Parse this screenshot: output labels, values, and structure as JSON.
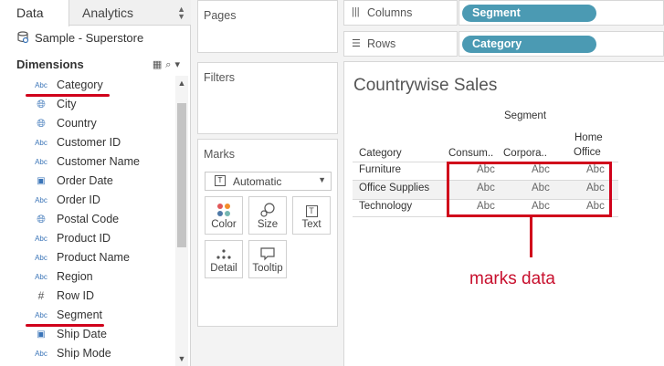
{
  "left_pane": {
    "tabs": [
      {
        "label": "Data"
      },
      {
        "label": "Analytics"
      }
    ],
    "datasource": "Sample - Superstore",
    "dimensions_title": "Dimensions",
    "fields": [
      {
        "type": "Abc",
        "label": "Category"
      },
      {
        "type": "globe",
        "label": "City"
      },
      {
        "type": "globe",
        "label": "Country"
      },
      {
        "type": "Abc",
        "label": "Customer ID"
      },
      {
        "type": "Abc",
        "label": "Customer Name"
      },
      {
        "type": "cal",
        "label": "Order Date"
      },
      {
        "type": "Abc",
        "label": "Order ID"
      },
      {
        "type": "globe",
        "label": "Postal Code"
      },
      {
        "type": "Abc",
        "label": "Product ID"
      },
      {
        "type": "Abc",
        "label": "Product Name"
      },
      {
        "type": "Abc",
        "label": "Region"
      },
      {
        "type": "#",
        "label": "Row ID"
      },
      {
        "type": "Abc",
        "label": "Segment"
      },
      {
        "type": "cal",
        "label": "Ship Date"
      },
      {
        "type": "Abc",
        "label": "Ship Mode"
      }
    ]
  },
  "cards": {
    "pages": "Pages",
    "filters": "Filters",
    "marks": {
      "title": "Marks",
      "type": "Automatic",
      "type_icon": "T",
      "buttons": [
        {
          "label": "Color",
          "icon": "color-icon"
        },
        {
          "label": "Size",
          "icon": "size-icon"
        },
        {
          "label": "Text",
          "icon": "text-icon",
          "glyph": "T"
        },
        {
          "label": "Detail",
          "icon": "detail-icon"
        },
        {
          "label": "Tooltip",
          "icon": "tooltip-icon"
        }
      ]
    }
  },
  "shelves": {
    "columns": {
      "label": "Columns",
      "pill": "Segment"
    },
    "rows": {
      "label": "Rows",
      "pill": "Category"
    }
  },
  "view": {
    "title": "Countrywise Sales",
    "column_field": "Segment",
    "row_field": "Category",
    "columns": [
      "Consum..",
      "Corpora..",
      "Home",
      "Office"
    ],
    "rows": [
      {
        "label": "Furniture",
        "cells": [
          "Abc",
          "Abc",
          "Abc"
        ]
      },
      {
        "label": "Office Supplies",
        "cells": [
          "Abc",
          "Abc",
          "Abc"
        ]
      },
      {
        "label": "Technology",
        "cells": [
          "Abc",
          "Abc",
          "Abc"
        ]
      }
    ]
  },
  "annotation": {
    "text": "marks data",
    "color": "#c8102e"
  },
  "colors": {
    "pill": "#4b9ab3",
    "highlight": "#d0021b",
    "field_icon": "#3b75b8"
  }
}
